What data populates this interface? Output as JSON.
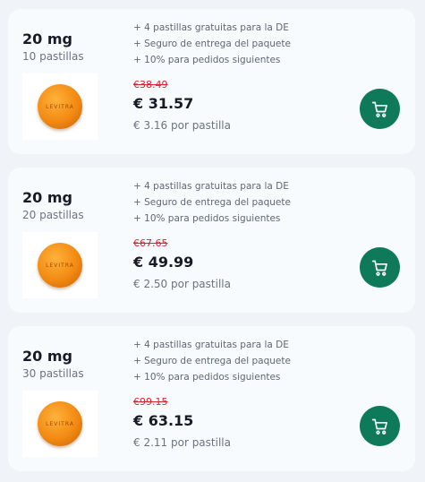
{
  "accent_color": "#0f7a5a",
  "old_price_color": "#d9232e",
  "products": [
    {
      "dose": "20 mg",
      "quantity": "10 pastillas",
      "pill_label": "LEVITRA",
      "features": [
        "+ 4 pastillas gratuitas para la DE",
        "+ Seguro de entrega del paquete",
        "+ 10% para pedidos siguientes"
      ],
      "old_price": "€38.49",
      "price": "€ 31.57",
      "per_pill": "€ 3.16 por pastilla",
      "cart_icon": "shopping-cart-icon"
    },
    {
      "dose": "20 mg",
      "quantity": "20 pastillas",
      "pill_label": "LEVITRA",
      "features": [
        "+ 4 pastillas gratuitas para la DE",
        "+ Seguro de entrega del paquete",
        "+ 10% para pedidos siguientes"
      ],
      "old_price": "€67.65",
      "price": "€ 49.99",
      "per_pill": "€ 2.50 por pastilla",
      "cart_icon": "shopping-cart-icon"
    },
    {
      "dose": "20 mg",
      "quantity": "30 pastillas",
      "pill_label": "LEVITRA",
      "features": [
        "+ 4 pastillas gratuitas para la DE",
        "+ Seguro de entrega del paquete",
        "+ 10% para pedidos siguientes"
      ],
      "old_price": "€99.15",
      "price": "€ 63.15",
      "per_pill": "€ 2.11 por pastilla",
      "cart_icon": "shopping-cart-icon"
    }
  ]
}
